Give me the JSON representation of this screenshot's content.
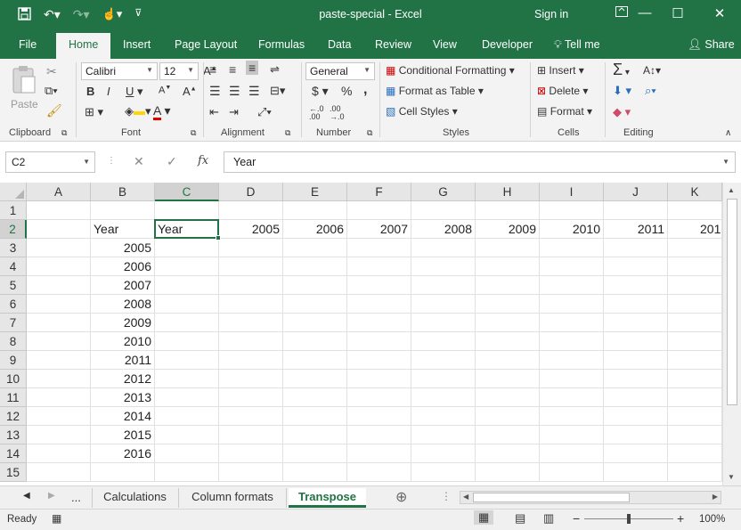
{
  "window": {
    "title": "paste-special - Excel",
    "sign_in": "Sign in"
  },
  "ribbon_tabs": [
    "File",
    "Home",
    "Insert",
    "Page Layout",
    "Formulas",
    "Data",
    "Review",
    "View",
    "Developer",
    "Tell me"
  ],
  "share_label": "Share",
  "clipboard": {
    "paste": "Paste",
    "label": "Clipboard"
  },
  "font": {
    "name": "Calibri",
    "size": "12",
    "label": "Font",
    "bold": "B",
    "italic": "I",
    "underline": "U",
    "increase": "A",
    "decrease": "A",
    "color_letter": "A"
  },
  "alignment": {
    "label": "Alignment"
  },
  "number": {
    "format": "General",
    "label": "Number",
    "currency": "$",
    "percent": "%",
    "comma": ","
  },
  "styles": {
    "conditional": "Conditional Formatting",
    "table": "Format as Table",
    "cell_styles": "Cell Styles",
    "label": "Styles"
  },
  "cells": {
    "insert": "Insert",
    "delete": "Delete",
    "format": "Format",
    "label": "Cells"
  },
  "editing": {
    "label": "Editing",
    "sigma": "Σ"
  },
  "formula_bar": {
    "name_box": "C2",
    "formula": "Year",
    "fx": "fx"
  },
  "columns": [
    "A",
    "B",
    "C",
    "D",
    "E",
    "F",
    "G",
    "H",
    "I",
    "J",
    "K"
  ],
  "rows": [
    "1",
    "2",
    "3",
    "4",
    "5",
    "6",
    "7",
    "8",
    "9",
    "10",
    "11",
    "12",
    "13",
    "14",
    "15"
  ],
  "cells_data": {
    "B2": "Year",
    "C2": "Year",
    "D2": "2005",
    "E2": "2006",
    "F2": "2007",
    "G2": "2008",
    "H2": "2009",
    "I2": "2010",
    "J2": "2011",
    "K2": "201",
    "B3": "2005",
    "B4": "2006",
    "B5": "2007",
    "B6": "2008",
    "B7": "2009",
    "B8": "2010",
    "B9": "2011",
    "B10": "2012",
    "B11": "2013",
    "B12": "2014",
    "B13": "2015",
    "B14": "2016"
  },
  "sheet_tabs": {
    "more": "...",
    "tabs": [
      "Calculations",
      "Column formats",
      "Transpose"
    ],
    "active": "Transpose"
  },
  "status": {
    "ready": "Ready",
    "zoom": "100%"
  },
  "colors": {
    "accent": "#217346"
  }
}
